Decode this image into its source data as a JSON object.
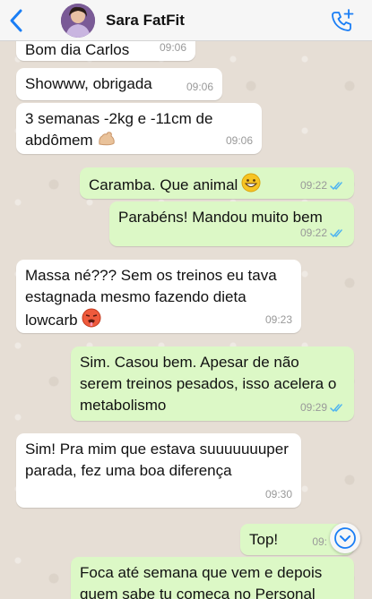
{
  "header": {
    "contact_name": "Sara FatFit"
  },
  "messages": [
    {
      "dir": "in",
      "text": "Bom dia Carlos",
      "time": "09:06"
    },
    {
      "dir": "in",
      "text": "Showww, obrigada",
      "time": "09:06"
    },
    {
      "dir": "in",
      "text": "3 semanas -2kg e -11cm de abdômem",
      "time": "09:06",
      "emoji": "flexed-biceps-icon"
    },
    {
      "dir": "out",
      "text": "Caramba. Que animal",
      "time": "09:22",
      "emoji": "grinning-face-icon",
      "read": true
    },
    {
      "dir": "out",
      "text": "Parabéns! Mandou muito bem",
      "time": "09:22",
      "read": true
    },
    {
      "dir": "in",
      "text": "Massa né??? Sem os treinos eu tava estagnada mesmo fazendo dieta lowcarb",
      "time": "09:23",
      "emoji": "hot-face-icon"
    },
    {
      "dir": "out",
      "text": "Sim. Casou bem. Apesar de não serem treinos pesados, isso acelera o metabolismo",
      "time": "09:29",
      "read": true
    },
    {
      "dir": "in",
      "text": "Sim! Pra mim que estava suuuuuuuper parada, fez uma boa diferença",
      "time": "09:30"
    },
    {
      "dir": "out",
      "text": "Top!",
      "time": "09:",
      "read": true
    },
    {
      "dir": "out",
      "text": "Foca até semana que vem e depois quem sabe tu começa no Personal",
      "time": ""
    }
  ],
  "colors": {
    "header_bg": "#f6f6f6",
    "chat_bg": "#e6ded5",
    "incoming_bubble": "#ffffff",
    "outgoing_bubble": "#dcf8c6",
    "accent_blue": "#1a7ef5",
    "read_ticks": "#4fb4f0"
  },
  "icons": {
    "back": "chevron-left-icon",
    "call": "add-call-icon",
    "scroll": "chevron-down-icon"
  }
}
